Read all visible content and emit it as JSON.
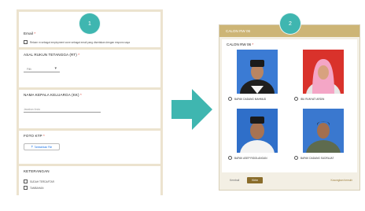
{
  "left_form": {
    "email": {
      "label": "Email",
      "required_mark": "*",
      "checkbox_text": "Rekam m sebagai employment zone sebagai email yang disertakan dengan respons saya"
    },
    "rt": {
      "label": "ASAL RUKUN TETANGGA (RT)",
      "required_mark": "*",
      "select_value": "Pilih"
    },
    "kk": {
      "label": "NAMA KEPALA KELUARGA (KK)",
      "required_mark": "*",
      "input_placeholder": "Jawaban Anda"
    },
    "ktp": {
      "label": "FOTO KTP",
      "required_mark": "*",
      "upload_label": "Tambahkan File"
    },
    "keterangan": {
      "label": "KETERANGAN",
      "options": [
        "SUDAH TERDAFTAR",
        "TAMBAHAN"
      ]
    }
  },
  "steps": {
    "one": "1",
    "two": "2"
  },
  "right_form": {
    "header": "CALON RW 06",
    "question": "CALON RW 06",
    "required_mark": "*",
    "candidates": [
      {
        "name": "BAPAK DADANG MAHMUD"
      },
      {
        "name": "IBU RUNYATI ARDIN"
      },
      {
        "name": "BAPAK ASEP RIDOLANGAN"
      },
      {
        "name": "BAPAK DADANG SUDRAJAT"
      }
    ],
    "footer": {
      "back_label": "Kembali",
      "next_label": "Kirim",
      "clear_label": "Kosongkan formulir"
    }
  },
  "colors": {
    "teal": "#3fb6b0",
    "gold": "#cdb576",
    "panel_bg": "#ece3cf",
    "button_brown": "#8a6d2b"
  },
  "icons": [
    "upload-icon",
    "chevron-down-icon",
    "arrow-right-icon"
  ]
}
